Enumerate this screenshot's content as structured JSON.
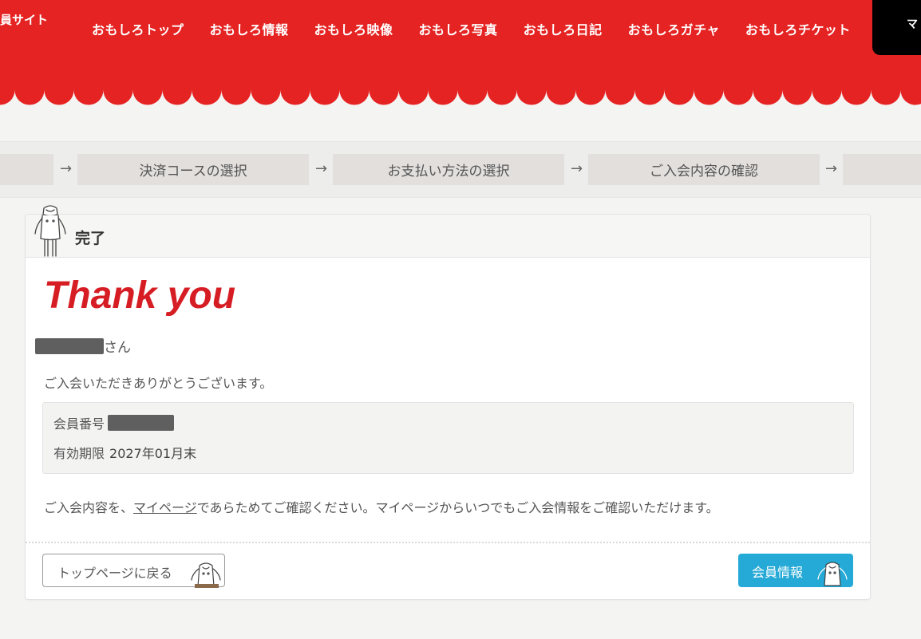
{
  "header": {
    "site_title": "員サイト",
    "mypage_label": "マ",
    "nav": [
      "おもしろトップ",
      "おもしろ情報",
      "おもしろ映像",
      "おもしろ写真",
      "おもしろ日記",
      "おもしろガチャ",
      "おもしろチケット"
    ]
  },
  "steps": {
    "items": [
      "決済コースの選択",
      "お支払い方法の選択",
      "ご入会内容の確認"
    ],
    "arrow": "→"
  },
  "card": {
    "title": "完了",
    "thankyou": "Thank you",
    "name_suffix": "さん",
    "message": "ご入会いただきありがとうございます。",
    "member_number_label": "会員番号",
    "expiry_label": "有効期限",
    "expiry_value": "2027年01月末",
    "note_prefix": "ご入会内容を、",
    "note_link": "マイページ",
    "note_suffix": "であらためてご確認ください。マイページからいつでもご入会情報をご確認いただけます。",
    "back_button": "トップページに戻る",
    "member_button": "会員情報"
  },
  "colors": {
    "header_red": "#e52322",
    "thankyou_red": "#d61d24",
    "member_button_blue": "#25a9d6"
  },
  "icons": [
    "mascot-icon",
    "mascot-icon",
    "mascot-icon"
  ]
}
